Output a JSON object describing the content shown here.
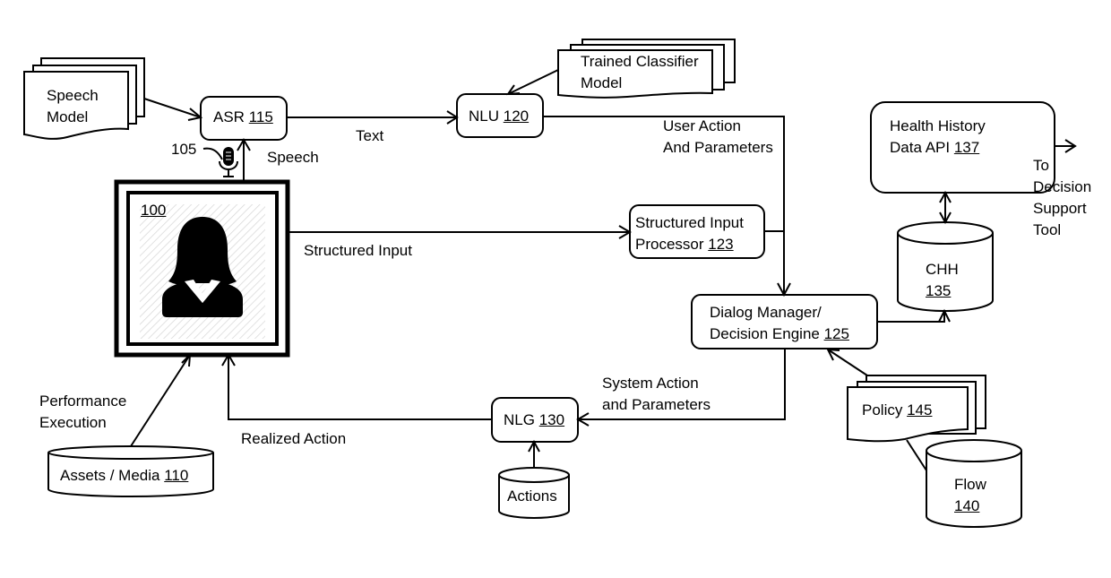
{
  "nodes": {
    "speech_model": {
      "line1": "Speech",
      "line2": "Model"
    },
    "asr": {
      "name": "ASR",
      "ref": "115"
    },
    "nlu": {
      "name": "NLU",
      "ref": "120"
    },
    "trained_classifier": {
      "line1": "Trained Classifier",
      "line2": "Model"
    },
    "avatar_display": {
      "ref": "100"
    },
    "microphone": {
      "ref": "105"
    },
    "structured_input_processor": {
      "line1": "Structured Input",
      "line2": "Processor",
      "ref": "123"
    },
    "dialog_manager": {
      "line1": "Dialog Manager/",
      "line2": "Decision Engine",
      "ref": "125"
    },
    "health_history_api": {
      "line1": "Health History",
      "line2": "Data API",
      "ref": "137"
    },
    "chh": {
      "name": "CHH",
      "ref": "135"
    },
    "policy": {
      "name": "Policy",
      "ref": "145"
    },
    "flow": {
      "name": "Flow",
      "ref": "140"
    },
    "nlg": {
      "name": "NLG",
      "ref": "130"
    },
    "actions": {
      "name": "Actions"
    },
    "assets_media": {
      "name": "Assets / Media",
      "ref": "110"
    }
  },
  "edge_labels": {
    "text": "Text",
    "speech": "Speech",
    "user_action_1": "User Action",
    "user_action_2": "And Parameters",
    "structured_input": "Structured Input",
    "system_action_1": "System Action",
    "system_action_2": "and Parameters",
    "realized_action": "Realized Action",
    "performance_1": "Performance",
    "performance_2": "Execution",
    "to_decision_1": "To",
    "to_decision_2": "Decision",
    "to_decision_3": "Support",
    "to_decision_4": "Tool"
  }
}
